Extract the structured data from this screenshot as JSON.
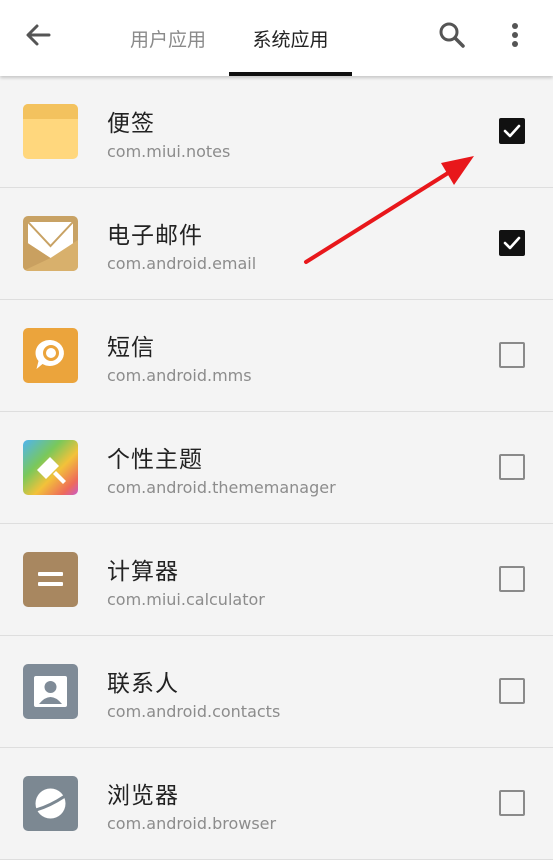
{
  "header": {
    "tabs": [
      {
        "label": "用户应用",
        "active": false
      },
      {
        "label": "系统应用",
        "active": true
      }
    ]
  },
  "apps": [
    {
      "name": "便签",
      "package": "com.miui.notes",
      "checked": true,
      "icon": "notes-icon"
    },
    {
      "name": "电子邮件",
      "package": "com.android.email",
      "checked": true,
      "icon": "email-icon"
    },
    {
      "name": "短信",
      "package": "com.android.mms",
      "checked": false,
      "icon": "message-icon"
    },
    {
      "name": "个性主题",
      "package": "com.android.thememanager",
      "checked": false,
      "icon": "theme-icon"
    },
    {
      "name": "计算器",
      "package": "com.miui.calculator",
      "checked": false,
      "icon": "calculator-icon"
    },
    {
      "name": "联系人",
      "package": "com.android.contacts",
      "checked": false,
      "icon": "contacts-icon"
    },
    {
      "name": "浏览器",
      "package": "com.android.browser",
      "checked": false,
      "icon": "browser-icon"
    }
  ],
  "colors": {
    "notes": "#ffd77d",
    "email": "#c8a264",
    "mms": "#eba43c",
    "calculator": "#a88760",
    "contacts": "#7f8b97",
    "browser": "#7c8892",
    "annotation_arrow": "#e8171b"
  }
}
